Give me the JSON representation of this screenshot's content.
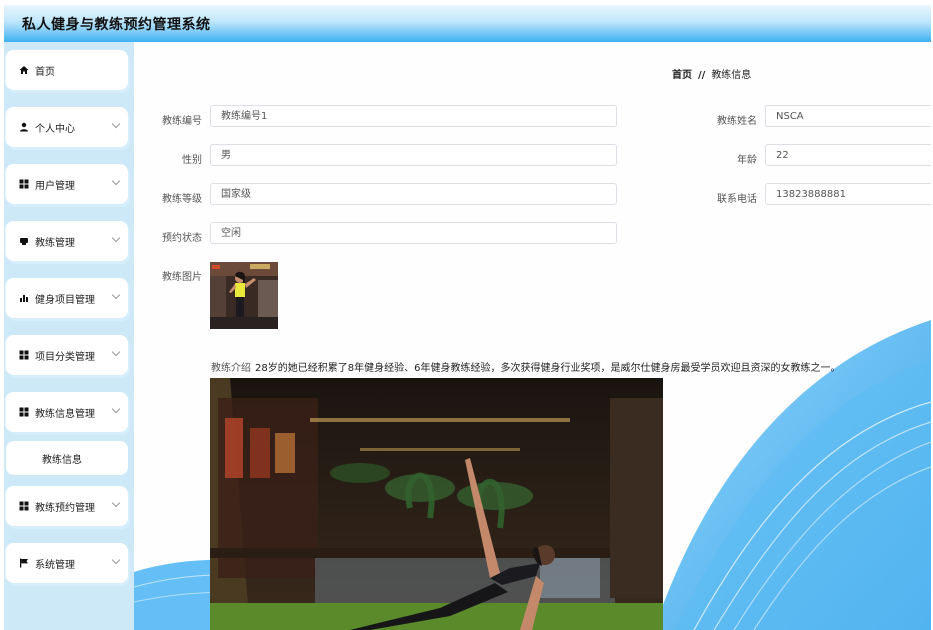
{
  "app": {
    "title": "私人健身与教练预约管理系统"
  },
  "sidebar": {
    "items": [
      {
        "label": "首页",
        "icon": "home-icon"
      },
      {
        "label": "个人中心",
        "icon": "user-icon"
      },
      {
        "label": "用户管理",
        "icon": "grid-icon"
      },
      {
        "label": "教练管理",
        "icon": "coach-icon"
      },
      {
        "label": "健身项目管理",
        "icon": "bar-chart-icon"
      },
      {
        "label": "项目分类管理",
        "icon": "grid-icon"
      },
      {
        "label": "教练信息管理",
        "icon": "grid-icon"
      },
      {
        "label": "教练预约管理",
        "icon": "grid-icon"
      },
      {
        "label": "系统管理",
        "icon": "flag-icon"
      }
    ],
    "sub_item": {
      "label": "教练信息"
    }
  },
  "breadcrumb": {
    "home": "首页",
    "separator": "//",
    "current": "教练信息"
  },
  "form": {
    "coach_id": {
      "label": "教练编号",
      "value": "教练编号1"
    },
    "coach_name": {
      "label": "教练姓名",
      "value": "NSCA"
    },
    "gender": {
      "label": "性别",
      "value": "男"
    },
    "age": {
      "label": "年龄",
      "value": "22"
    },
    "level": {
      "label": "教练等级",
      "value": "国家级"
    },
    "phone": {
      "label": "联系电话",
      "value": "13823888881"
    },
    "booking_status": {
      "label": "预约状态",
      "value": "空闲"
    },
    "photo": {
      "label": "教练图片"
    },
    "intro": {
      "label": "教练介绍",
      "value": "28岁的她已经积累了8年健身经验、6年健身教练经验，多次获得健身行业奖项，是威尔仕健身房最受学员欢迎且资深的女教练之一。"
    }
  },
  "colors": {
    "accent": "#3fb0f0",
    "sidebar_bg": "#cde9f8",
    "wave": "#4ab3f4"
  }
}
